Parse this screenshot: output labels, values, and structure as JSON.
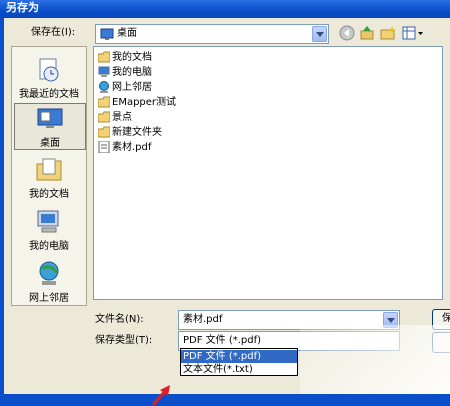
{
  "window": {
    "title": "另存为"
  },
  "save_in": {
    "label": "保存在(I):",
    "value": "桌面"
  },
  "toolbar": {
    "icons": [
      "back-icon",
      "up-folder-icon",
      "new-folder-icon",
      "view-menu-icon"
    ]
  },
  "places": [
    {
      "label": "我最近的文档",
      "icon": "recent-documents-icon"
    },
    {
      "label": "桌面",
      "icon": "desktop-icon",
      "selected": true
    },
    {
      "label": "我的文档",
      "icon": "my-documents-icon"
    },
    {
      "label": "我的电脑",
      "icon": "my-computer-icon"
    },
    {
      "label": "网上邻居",
      "icon": "network-places-icon"
    }
  ],
  "files": [
    {
      "name": "我的文档",
      "icon": "my-documents-icon"
    },
    {
      "name": "我的电脑",
      "icon": "my-computer-icon"
    },
    {
      "name": "网上邻居",
      "icon": "network-places-icon"
    },
    {
      "name": "EMapper测试",
      "icon": "folder-icon"
    },
    {
      "name": "景点",
      "icon": "folder-icon"
    },
    {
      "name": "新建文件夹",
      "icon": "folder-icon"
    },
    {
      "name": "素材.pdf",
      "icon": "pdf-file-icon"
    }
  ],
  "filename": {
    "label": "文件名(N):",
    "value": "素材.pdf"
  },
  "filetype": {
    "label": "保存类型(T):",
    "value": "PDF 文件 (*.pdf)",
    "options": [
      "PDF 文件 (*.pdf)",
      "文本文件(*.txt)"
    ]
  },
  "buttons": {
    "save_label": "保",
    "cancel_label": ""
  },
  "colors": {
    "titlebar": "#0a4ec9",
    "dialog_bg": "#ece9d8",
    "selection": "#316ac5",
    "arrow": "#e02020"
  }
}
